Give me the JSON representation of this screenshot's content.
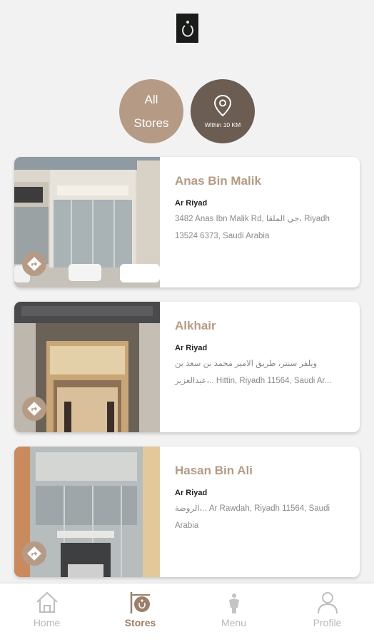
{
  "filters": {
    "all": {
      "line1": "All",
      "line2": "Stores"
    },
    "nearby": {
      "label": "Within 10 KM",
      "icon": "location-pin-icon"
    }
  },
  "stores": [
    {
      "name": "Anas Bin Malik",
      "city": "Ar Riyad",
      "address": "3482 Anas Ibn Malik Rd, حي الملقا، Riyadh 13524 6373, Saudi Arabia"
    },
    {
      "name": "Alkhair",
      "city": "Ar Riyad",
      "address": "ويلفر سنتر، طريق الامير محمد بن سعد بن عبدالعزيز،.. Hittin, Riyadh 11564, Saudi Ar..."
    },
    {
      "name": "Hasan Bin Ali",
      "city": "Ar Riyad",
      "address": "الروضة،.. Ar Rawdah, Riyadh 11564, Saudi Arabia"
    }
  ],
  "nav": [
    {
      "label": "Home",
      "icon": "home-icon",
      "active": false
    },
    {
      "label": "Stores",
      "icon": "store-sign-icon",
      "active": true
    },
    {
      "label": "Menu",
      "icon": "tailor-icon",
      "active": false
    },
    {
      "label": "Profile",
      "icon": "user-icon",
      "active": false
    }
  ],
  "colors": {
    "accent": "#b59b85",
    "dark_accent": "#6b5d52",
    "active_nav": "#9b7f68",
    "logo_bg": "#1a1c1b"
  }
}
